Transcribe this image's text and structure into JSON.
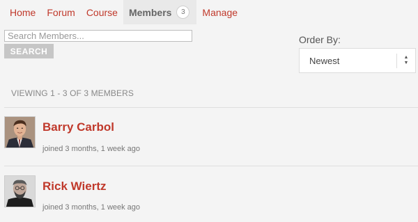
{
  "nav": {
    "items": [
      {
        "label": "Home"
      },
      {
        "label": "Forum"
      },
      {
        "label": "Course"
      },
      {
        "label": "Members",
        "count": "3",
        "active": true
      },
      {
        "label": "Manage"
      }
    ]
  },
  "search": {
    "placeholder": "Search Members...",
    "value": "",
    "button_label": "SEARCH"
  },
  "order": {
    "label": "Order By:",
    "selected": "Newest"
  },
  "summary": {
    "viewing_text": "VIEWING 1 - 3 OF 3 MEMBERS"
  },
  "members": [
    {
      "name": "Barry Carbol",
      "joined": "joined 3 months, 1 week ago",
      "avatar": "avatar-barry"
    },
    {
      "name": "Rick Wiertz",
      "joined": "joined 3 months, 1 week ago",
      "avatar": "avatar-rick"
    }
  ],
  "colors": {
    "accent": "#c0392b",
    "background": "#f4f4f4",
    "active_tab": "#e9e9e9",
    "button": "#c6c6c6"
  }
}
